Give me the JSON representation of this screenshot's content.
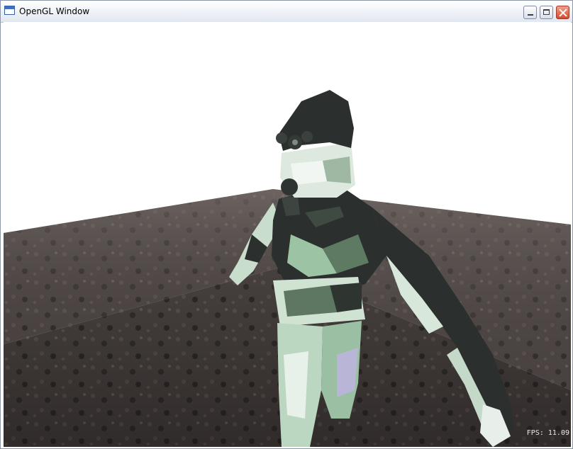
{
  "window": {
    "title": "OpenGL Window",
    "controls": {
      "minimize": "minimize-icon",
      "maximize": "maximize-icon",
      "close": "close-icon"
    },
    "icon": "opengl-window-icon"
  },
  "viewport": {
    "fps_label": "FPS: 11.09"
  },
  "colors": {
    "background": "#ffffff",
    "floor": "#3b3634",
    "wall": "#6e6461",
    "character_dark": "#2b2f2d",
    "character_light": "#c9e0cd"
  }
}
